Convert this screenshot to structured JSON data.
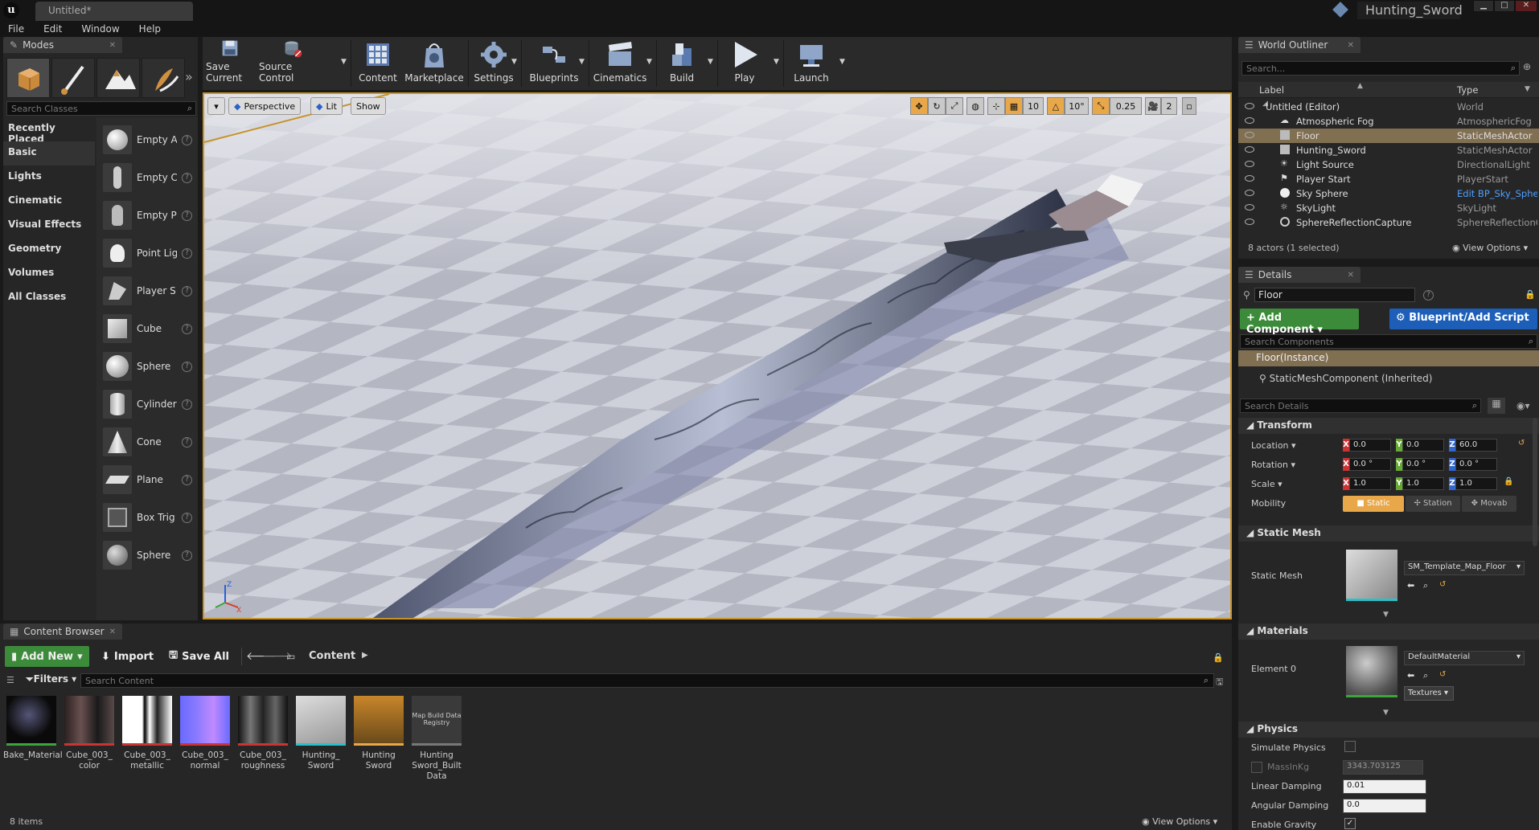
{
  "titlebar": {
    "doc_tab": "Untitled*",
    "project_name": "Hunting_Sword"
  },
  "menubar": [
    "File",
    "Edit",
    "Window",
    "Help"
  ],
  "modes": {
    "tab": "Modes",
    "search_placeholder": "Search Classes",
    "categories": [
      "Recently Placed",
      "Basic",
      "Lights",
      "Cinematic",
      "Visual Effects",
      "Geometry",
      "Volumes",
      "All Classes"
    ],
    "active_category": "Basic",
    "items": [
      "Empty A",
      "Empty C",
      "Empty P",
      "Point Lig",
      "Player S",
      "Cube",
      "Sphere",
      "Cylinder",
      "Cone",
      "Plane",
      "Box Trig",
      "Sphere "
    ]
  },
  "toolbar": {
    "buttons": [
      "Save Current",
      "Source Control",
      "Content",
      "Marketplace",
      "Settings",
      "Blueprints",
      "Cinematics",
      "Build",
      "Play",
      "Launch"
    ]
  },
  "viewport": {
    "perspective": "Perspective",
    "lit": "Lit",
    "show": "Show",
    "grid_snap": "10",
    "rot_snap": "10°",
    "scale_snap": "0.25",
    "camera_speed": "2"
  },
  "outliner": {
    "tab": "World Outliner",
    "search_placeholder": "Search...",
    "col_label": "Label",
    "col_type": "Type",
    "rows": [
      {
        "label": "Untitled (Editor)",
        "type": "World"
      },
      {
        "label": "Atmospheric Fog",
        "type": "AtmosphericFog"
      },
      {
        "label": "Floor",
        "type": "StaticMeshActor"
      },
      {
        "label": "Hunting_Sword",
        "type": "StaticMeshActor"
      },
      {
        "label": "Light Source",
        "type": "DirectionalLight"
      },
      {
        "label": "Player Start",
        "type": "PlayerStart"
      },
      {
        "label": "Sky Sphere",
        "type": "Edit BP_Sky_Sphe"
      },
      {
        "label": "SkyLight",
        "type": "SkyLight"
      },
      {
        "label": "SphereReflectionCapture",
        "type": "SphereReflectionC"
      }
    ],
    "footer": "8 actors (1 selected)",
    "view_options": "View Options"
  },
  "details": {
    "tab": "Details",
    "name_value": "Floor",
    "add_component": "Add Component",
    "blueprint_script": "Blueprint/Add Script",
    "search_components": "Search Components",
    "instance": "Floor(Instance)",
    "component": "StaticMeshComponent (Inherited)",
    "search_details": "Search Details",
    "transform": {
      "header": "Transform",
      "location_label": "Location",
      "rotation_label": "Rotation",
      "scale_label": "Scale",
      "mobility_label": "Mobility",
      "location": [
        "0.0",
        "0.0",
        "60.0"
      ],
      "rotation": [
        "0.0 °",
        "0.0 °",
        "0.0 °"
      ],
      "scale": [
        "1.0",
        "1.0",
        "1.0"
      ],
      "mobility": [
        "Static",
        "Station",
        "Movab"
      ]
    },
    "static_mesh": {
      "header": "Static Mesh",
      "label": "Static Mesh",
      "value": "SM_Template_Map_Floor"
    },
    "materials": {
      "header": "Materials",
      "label": "Element 0",
      "value": "DefaultMaterial",
      "textures": "Textures"
    },
    "physics": {
      "header": "Physics",
      "simulate": "Simulate Physics",
      "mass_label": "MassInKg",
      "mass": "3343.703125",
      "linear_label": "Linear Damping",
      "linear": "0.01",
      "angular_label": "Angular Damping",
      "angular": "0.0",
      "gravity_label": "Enable Gravity"
    }
  },
  "content_browser": {
    "tab": "Content Browser",
    "add_new": "Add New",
    "import": "Import",
    "save_all": "Save All",
    "path": "Content",
    "filters": "Filters",
    "search_placeholder": "Search Content",
    "assets": [
      "Bake_Material",
      "Cube_003_ color",
      "Cube_003_ metallic",
      "Cube_003_ normal",
      "Cube_003_ roughness",
      "Hunting_ Sword",
      "Hunting Sword",
      "Hunting Sword_Built Data"
    ],
    "registry_thumb": "Map Build Data Registry",
    "footer": "8 items",
    "view_options": "View Options"
  }
}
